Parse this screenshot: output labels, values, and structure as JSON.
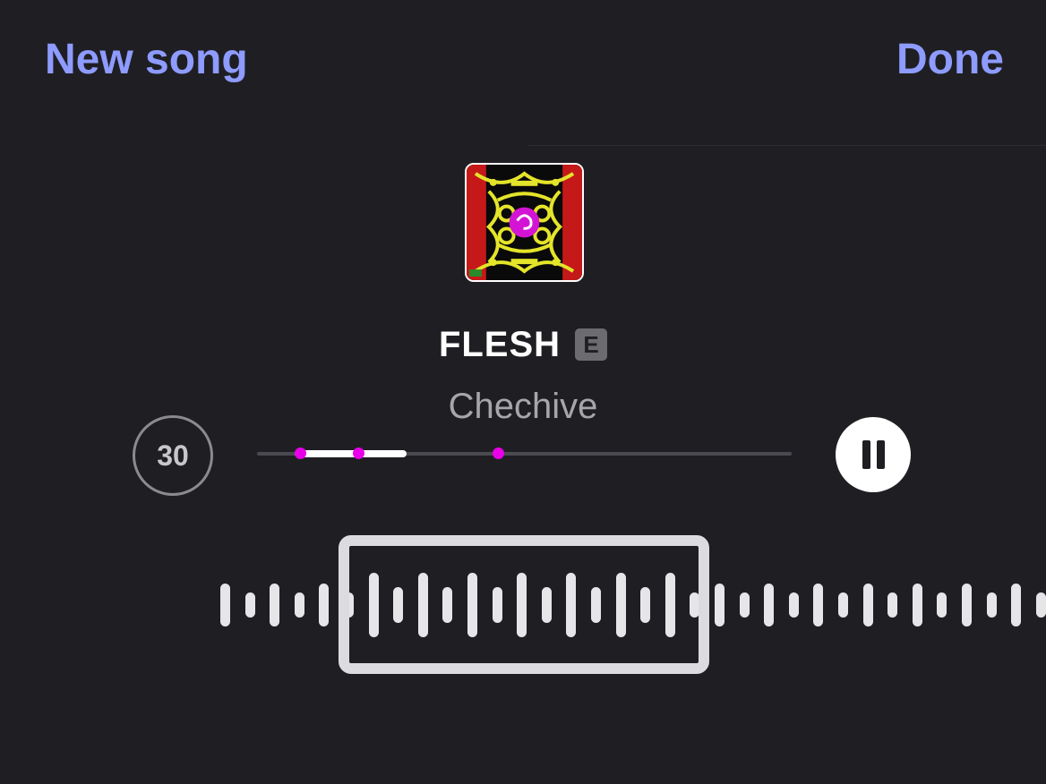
{
  "nav": {
    "left_label": "New song",
    "right_label": "Done"
  },
  "song": {
    "title": "FLESH",
    "explicit_badge": "E",
    "artist": "Chechive"
  },
  "controls": {
    "clip_duration": "30",
    "play_state": "playing"
  },
  "progress": {
    "played_start_fraction": 0.07,
    "played_end_fraction": 0.28,
    "marker_fractions": [
      0.08,
      0.19,
      0.45
    ]
  },
  "colors": {
    "accent": "#8e9bff",
    "background": "#1f1f23",
    "marker": "#e800e8"
  },
  "icons": {
    "artwork": "album-artwork",
    "pause": "pause-icon"
  }
}
